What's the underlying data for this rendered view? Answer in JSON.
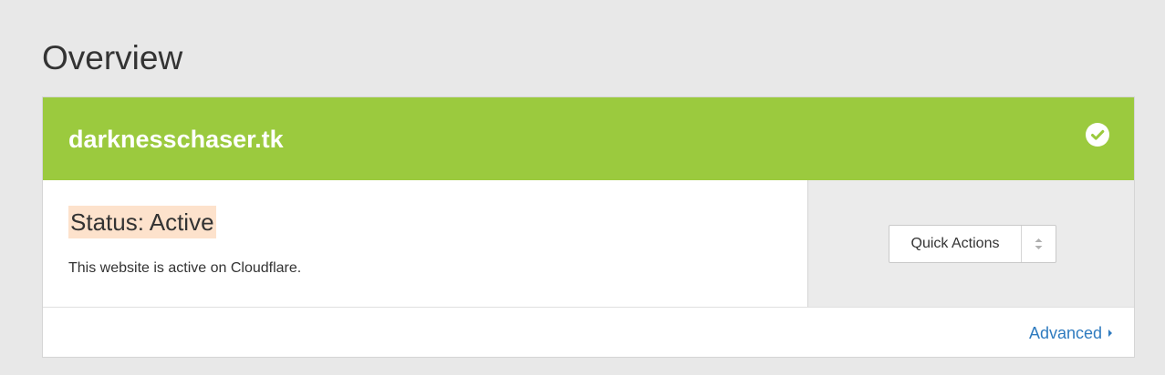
{
  "page": {
    "title": "Overview"
  },
  "site": {
    "domain": "darknesschaser.tk",
    "status_icon": "check-circle-icon"
  },
  "status": {
    "title": "Status: Active",
    "description": "This website is active on Cloudflare."
  },
  "actions": {
    "quick_actions_label": "Quick Actions",
    "arrows_icon": "sort-arrows-icon"
  },
  "footer": {
    "advanced_label": "Advanced",
    "advanced_icon": "caret-right-icon"
  },
  "colors": {
    "header_green": "#9bca3e",
    "highlight": "#fde2cc",
    "link_blue": "#2f7bbf",
    "background": "#e8e8e8"
  }
}
